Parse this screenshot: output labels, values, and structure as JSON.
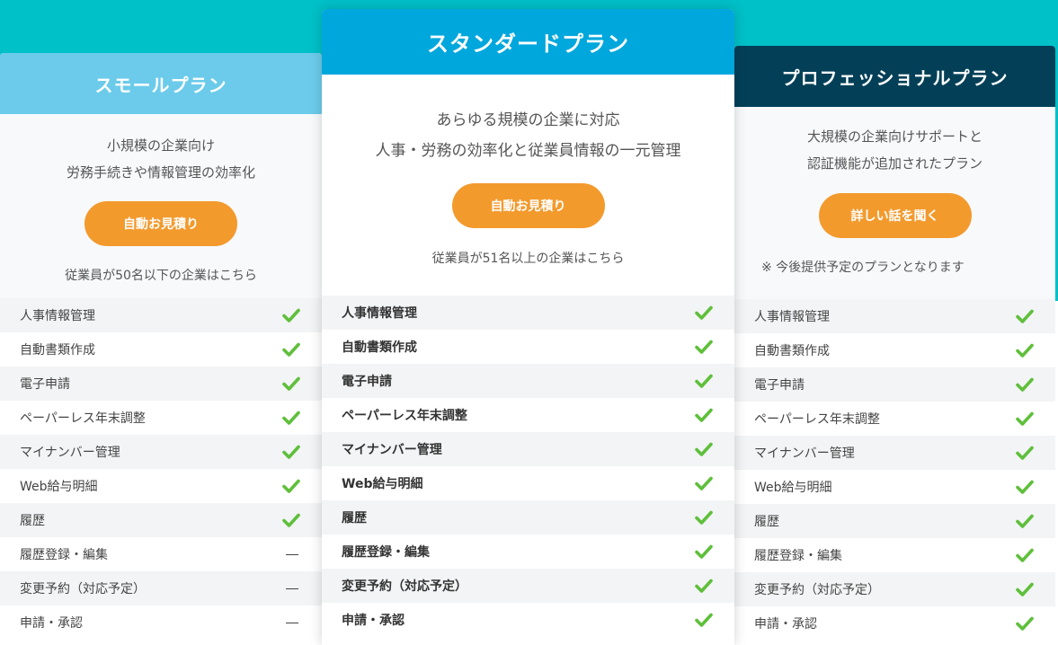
{
  "colors": {
    "background": "#00c0c8",
    "small_header": "#6ccbea",
    "standard_header": "#00a7dc",
    "pro_header": "#034058",
    "button": "#f39a2d",
    "check": "#5fbf3b"
  },
  "plans": [
    {
      "title": "スモールプラン",
      "desc_line1": "小規模の企業向け",
      "desc_line2": "労務手続きや情報管理の効率化",
      "button": "自動お見積り",
      "note": "従業員が50名以下の企業はこちら",
      "features": [
        {
          "label": "人事情報管理",
          "status": "check"
        },
        {
          "label": "自動書類作成",
          "status": "check"
        },
        {
          "label": "電子申請",
          "status": "check"
        },
        {
          "label": "ペーパーレス年末調整",
          "status": "check"
        },
        {
          "label": "マイナンバー管理",
          "status": "check"
        },
        {
          "label": "Web給与明細",
          "status": "check"
        },
        {
          "label": "履歴",
          "status": "check"
        },
        {
          "label": "履歴登録・編集",
          "status": "dash"
        },
        {
          "label": "変更予約（対応予定）",
          "status": "dash"
        },
        {
          "label": "申請・承認",
          "status": "dash"
        }
      ]
    },
    {
      "title": "スタンダードプラン",
      "desc_line1": "あらゆる規模の企業に対応",
      "desc_line2": "人事・労務の効率化と従業員情報の一元管理",
      "button": "自動お見積り",
      "note": "従業員が51名以上の企業はこちら",
      "features": [
        {
          "label": "人事情報管理",
          "status": "check"
        },
        {
          "label": "自動書類作成",
          "status": "check"
        },
        {
          "label": "電子申請",
          "status": "check"
        },
        {
          "label": "ペーパーレス年末調整",
          "status": "check"
        },
        {
          "label": "マイナンバー管理",
          "status": "check"
        },
        {
          "label": "Web給与明細",
          "status": "check"
        },
        {
          "label": "履歴",
          "status": "check"
        },
        {
          "label": "履歴登録・編集",
          "status": "check"
        },
        {
          "label": "変更予約（対応予定）",
          "status": "check"
        },
        {
          "label": "申請・承認",
          "status": "check"
        }
      ]
    },
    {
      "title": "プロフェッショナルプラン",
      "desc_line1": "大規模の企業向けサポートと",
      "desc_line2": "認証機能が追加されたプラン",
      "button": "詳しい話を聞く",
      "note": "※ 今後提供予定のプランとなります",
      "features": [
        {
          "label": "人事情報管理",
          "status": "check"
        },
        {
          "label": "自動書類作成",
          "status": "check"
        },
        {
          "label": "電子申請",
          "status": "check"
        },
        {
          "label": "ペーパーレス年末調整",
          "status": "check"
        },
        {
          "label": "マイナンバー管理",
          "status": "check"
        },
        {
          "label": "Web給与明細",
          "status": "check"
        },
        {
          "label": "履歴",
          "status": "check"
        },
        {
          "label": "履歴登録・編集",
          "status": "check"
        },
        {
          "label": "変更予約（対応予定）",
          "status": "check"
        },
        {
          "label": "申請・承認",
          "status": "check"
        }
      ]
    }
  ]
}
